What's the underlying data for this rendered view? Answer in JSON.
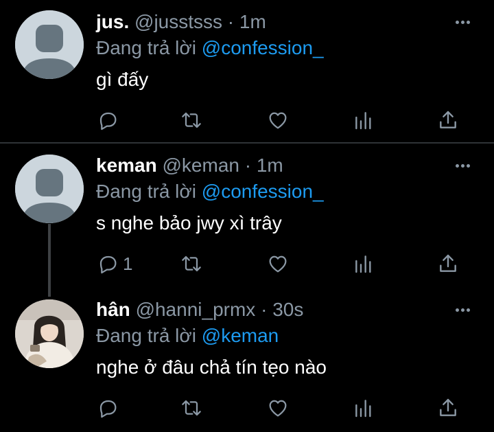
{
  "tweets": [
    {
      "name": "jus.",
      "handle": "@jusstsss",
      "separator": "·",
      "time": "1m",
      "replying_prefix": "Đang trả lời",
      "replying_to": "@confession_",
      "text": "gì đấy",
      "reply_count": "",
      "avatar": "default-avatar"
    },
    {
      "name": "keman",
      "handle": "@keman",
      "separator": "·",
      "time": "1m",
      "replying_prefix": "Đang trả lời",
      "replying_to": "@confession_",
      "text": "s nghe bảo jwy xì trây",
      "reply_count": "1",
      "avatar": "default-avatar"
    },
    {
      "name": "hân",
      "handle": "@hanni_prmx",
      "separator": "·",
      "time": "30s",
      "replying_prefix": "Đang trả lời",
      "replying_to": "@keman",
      "text": "nghe ở đâu chả tín tẹo nào",
      "reply_count": "",
      "avatar": "photo-avatar"
    }
  ],
  "colors": {
    "background": "#000000",
    "text": "#ffffff",
    "secondary": "#8b98a5",
    "mention": "#1d9bf0",
    "divider": "#2f3336"
  },
  "icons": [
    "reply-icon",
    "retweet-icon",
    "like-icon",
    "stats-icon",
    "share-icon",
    "more-icon"
  ]
}
